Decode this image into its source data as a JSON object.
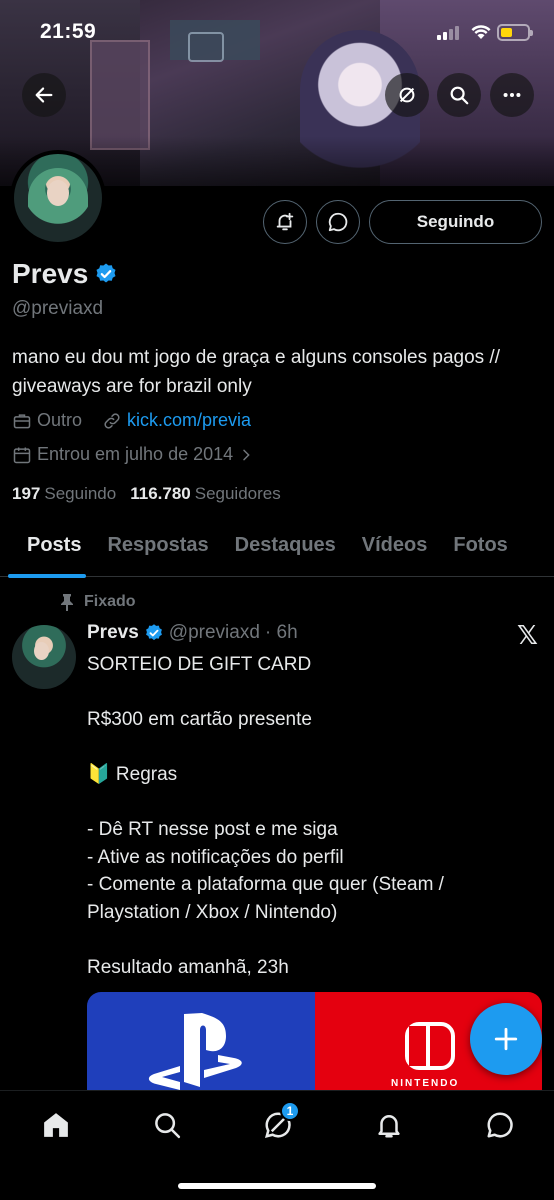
{
  "status_bar": {
    "time": "21:59"
  },
  "profile": {
    "name": "Prevs",
    "handle": "@previaxd",
    "bio": "mano eu dou mt jogo de graça e alguns consoles pagos // giveaways are for brazil only",
    "category": "Outro",
    "link": "kick.com/previa",
    "joined": "Entrou em julho de 2014",
    "following_count": "197",
    "following_label": "Seguindo",
    "followers_count": "116.780",
    "followers_label": "Seguidores",
    "follow_button": "Seguindo"
  },
  "tabs": [
    "Posts",
    "Respostas",
    "Destaques",
    "Vídeos",
    "Fotos"
  ],
  "active_tab": "Posts",
  "pinned_post": {
    "pinned_label": "Fixado",
    "author_name": "Prevs",
    "author_handle": "@previaxd",
    "time": "· 6h",
    "text": "SORTEIO DE GIFT CARD\n\nR$300 em cartão presente\n\n🔰 Regras\n\n- Dê RT nesse post e me siga\n- Ative as notificações do perfil\n- Comente a plataforma que quer (Steam / Playstation / Xbox / Nintendo)\n\nResultado amanhã, 23h",
    "media_label": "NINTENDO"
  },
  "bottom_nav": {
    "notification_badge": "1"
  },
  "colors": {
    "accent": "#1d9bf0",
    "background": "#000000",
    "secondary_text": "#71767b"
  }
}
